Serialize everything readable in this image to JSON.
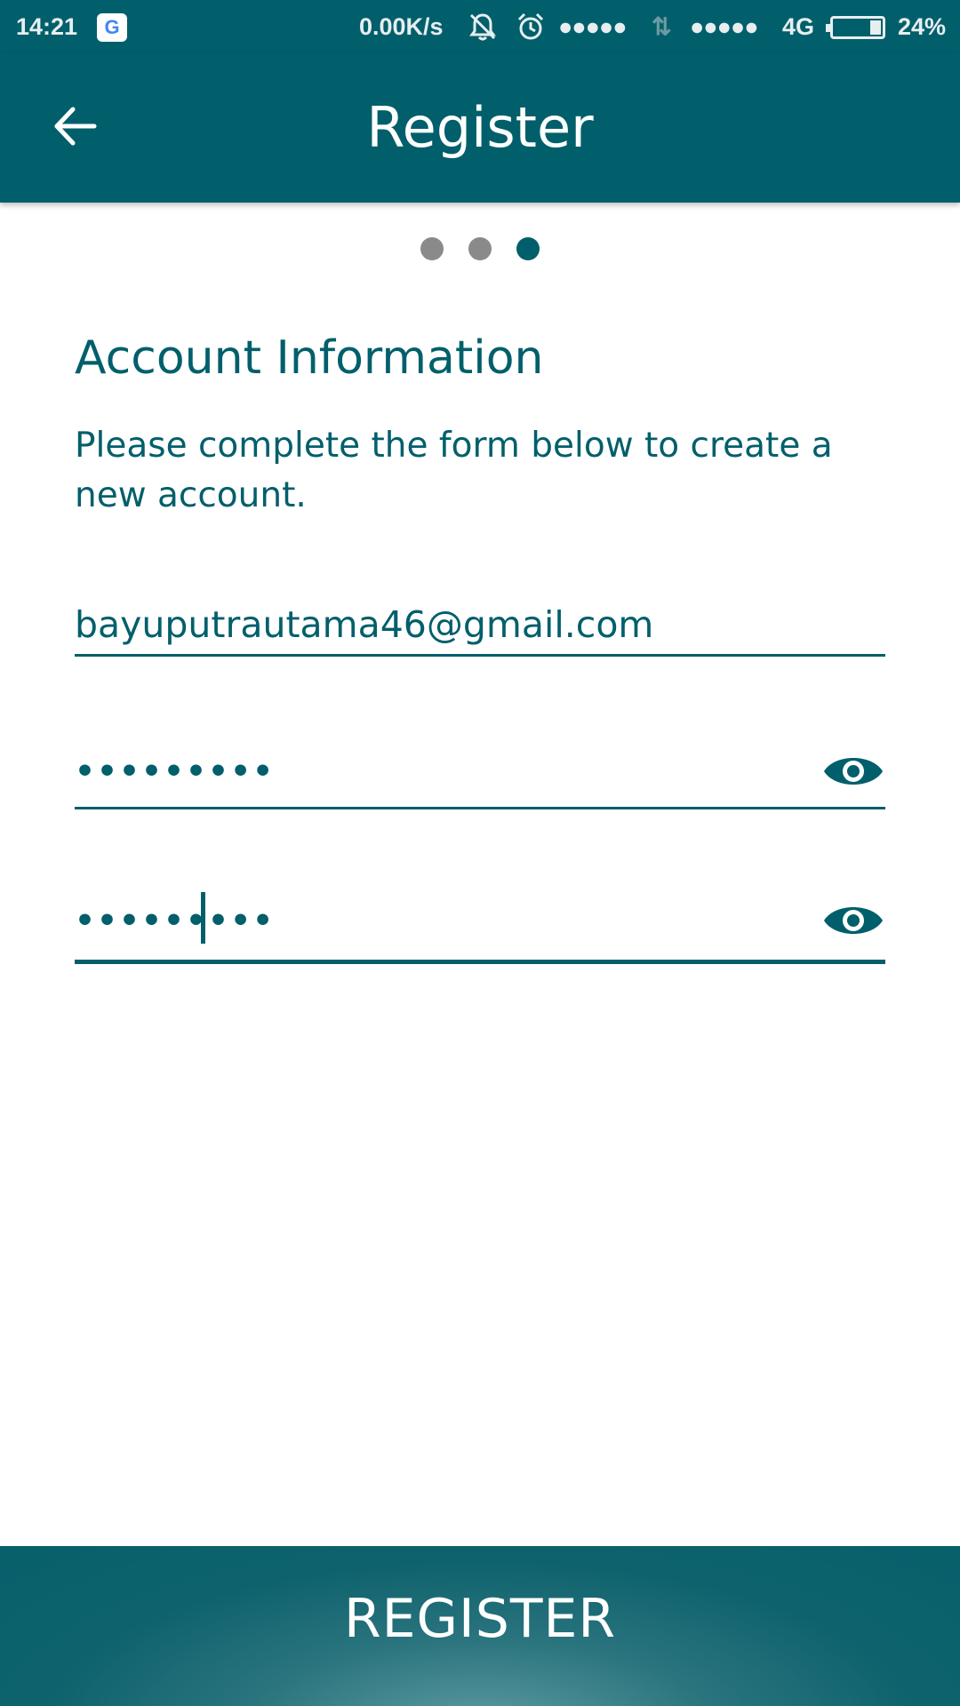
{
  "status_bar": {
    "time": "14:21",
    "notification_icon": "google-g-icon",
    "notification_glyph": "G",
    "net_speed": "0.00K/s",
    "signal_1": "●●●●●",
    "data_arrows": "⇅",
    "signal_2": "●●●●●",
    "network": "4G",
    "battery_level": 0.24,
    "battery_percent": "24%"
  },
  "app_bar": {
    "title": "Register",
    "back_icon": "arrow-left-icon"
  },
  "stepper": {
    "steps": 3,
    "current_step": 3
  },
  "form": {
    "heading": "Account Information",
    "description": "Please complete the form below to create a new account.",
    "email": {
      "value": "bayuputrautama46@gmail.com"
    },
    "password": {
      "value": "•••••••••"
    },
    "confirm_password": {
      "value": "•••••••••"
    },
    "toggle_icon": "eye-icon"
  },
  "footer": {
    "register_label": "REGISTER"
  },
  "colors": {
    "primary": "#015f6b",
    "inactive_dot": "#8a8a8a",
    "white": "#ffffff"
  }
}
